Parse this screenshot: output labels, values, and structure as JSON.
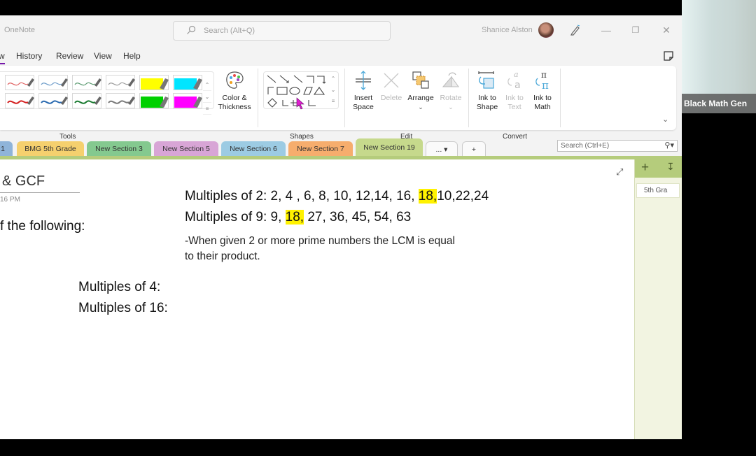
{
  "window": {
    "app_name": "OneNote",
    "search_placeholder": "Search (Alt+Q)",
    "user_name": "Shanice Alston"
  },
  "menu": {
    "items": [
      "w",
      "History",
      "Review",
      "View",
      "Help"
    ],
    "active_index": 0
  },
  "ribbon": {
    "tools_group_label": "Tools",
    "color_thickness_label": [
      "Color &",
      "Thickness"
    ],
    "pens_row1": [
      {
        "type": "pen",
        "color": "#e06060"
      },
      {
        "type": "pen",
        "color": "#6a9ac8"
      },
      {
        "type": "pen",
        "color": "#5a9a70"
      },
      {
        "type": "pen",
        "color": "#9a9a9a"
      },
      {
        "type": "highlighter",
        "color": "#ffff00"
      },
      {
        "type": "highlighter",
        "color": "#00e5ff"
      }
    ],
    "pens_row2": [
      {
        "type": "pen",
        "color": "#d42020"
      },
      {
        "type": "pen",
        "color": "#2a6ab0"
      },
      {
        "type": "pen",
        "color": "#1a7a30"
      },
      {
        "type": "pen",
        "color": "#7a7a7a"
      },
      {
        "type": "highlighter",
        "color": "#00d000"
      },
      {
        "type": "highlighter",
        "color": "#ff00ff"
      }
    ],
    "shapes_group_label": "Shapes",
    "edit_group_label": "Edit",
    "insert_space_label": [
      "Insert",
      "Space"
    ],
    "delete_label": "Delete",
    "arrange_label": "Arrange",
    "rotate_label": "Rotate",
    "convert_group_label": "Convert",
    "ink_to_shape_label": [
      "Ink to",
      "Shape"
    ],
    "ink_to_text_label": [
      "Ink to",
      "Text"
    ],
    "ink_to_math_label": [
      "Ink to",
      "Math"
    ]
  },
  "sections": {
    "tabs": [
      {
        "label": "1",
        "color": "#8fb4d9"
      },
      {
        "label": "BMG 5th Grade",
        "color": "#f5d06e"
      },
      {
        "label": "New Section 3",
        "color": "#84c98f"
      },
      {
        "label": "New Section 5",
        "color": "#d8a5d6"
      },
      {
        "label": "New Section 6",
        "color": "#9ccbe3"
      },
      {
        "label": "New Section 7",
        "color": "#f6ad6d"
      },
      {
        "label": "New Section 19",
        "color": "#c6d98c",
        "active": true
      }
    ],
    "more_label": "... ▾",
    "add_label": "+",
    "search_placeholder": "Search (Ctrl+E)"
  },
  "page": {
    "title": "& GCF",
    "date": "16 PM",
    "instruction": "f the following:",
    "line1_prefix": "Multiples of 2: 2, 4 , 6, 8, 10, 12,14, 16, ",
    "line1_highlight": "18,",
    "line1_suffix": "10,22,24",
    "line2_prefix": "Multiples of 9: 9, ",
    "line2_highlight": "18,",
    "line2_suffix": " 27, 36, 45, 54, 63",
    "note1": "-When given 2 or more prime numbers the LCM is equal",
    "note2": "to their product.",
    "line3": "Multiples of 4:",
    "line4": "Multiples of 16:",
    "highlight_color": "#fff200"
  },
  "page_list": {
    "items": [
      "5th Gra"
    ]
  },
  "video": {
    "participant_label": "Black Math Gen"
  }
}
